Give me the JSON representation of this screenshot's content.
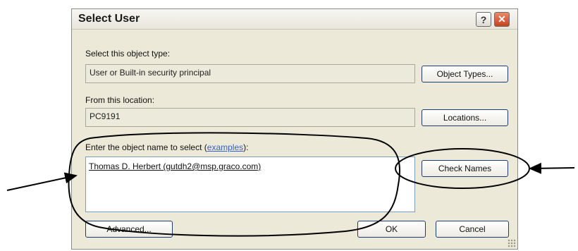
{
  "dialog": {
    "title": "Select User",
    "help_icon": "question-mark-icon",
    "close_icon": "close-x-icon"
  },
  "object_type": {
    "label": "Select this object type:",
    "value": "User or Built-in security principal",
    "button": "Object Types..."
  },
  "location": {
    "label": "From this location:",
    "value": "PC9191",
    "button": "Locations..."
  },
  "names": {
    "label_prefix": "Enter the object name to select (",
    "label_link": "examples",
    "label_suffix": "):",
    "value": "Thomas D. Herbert (gutdh2@msp.graco.com)",
    "check_button": "Check Names"
  },
  "footer": {
    "advanced": "Advanced...",
    "ok": "OK",
    "cancel": "Cancel"
  },
  "colors": {
    "dialog_bg": "#ece9d8",
    "close_button": "#c9401d",
    "annotation": "#000000"
  }
}
